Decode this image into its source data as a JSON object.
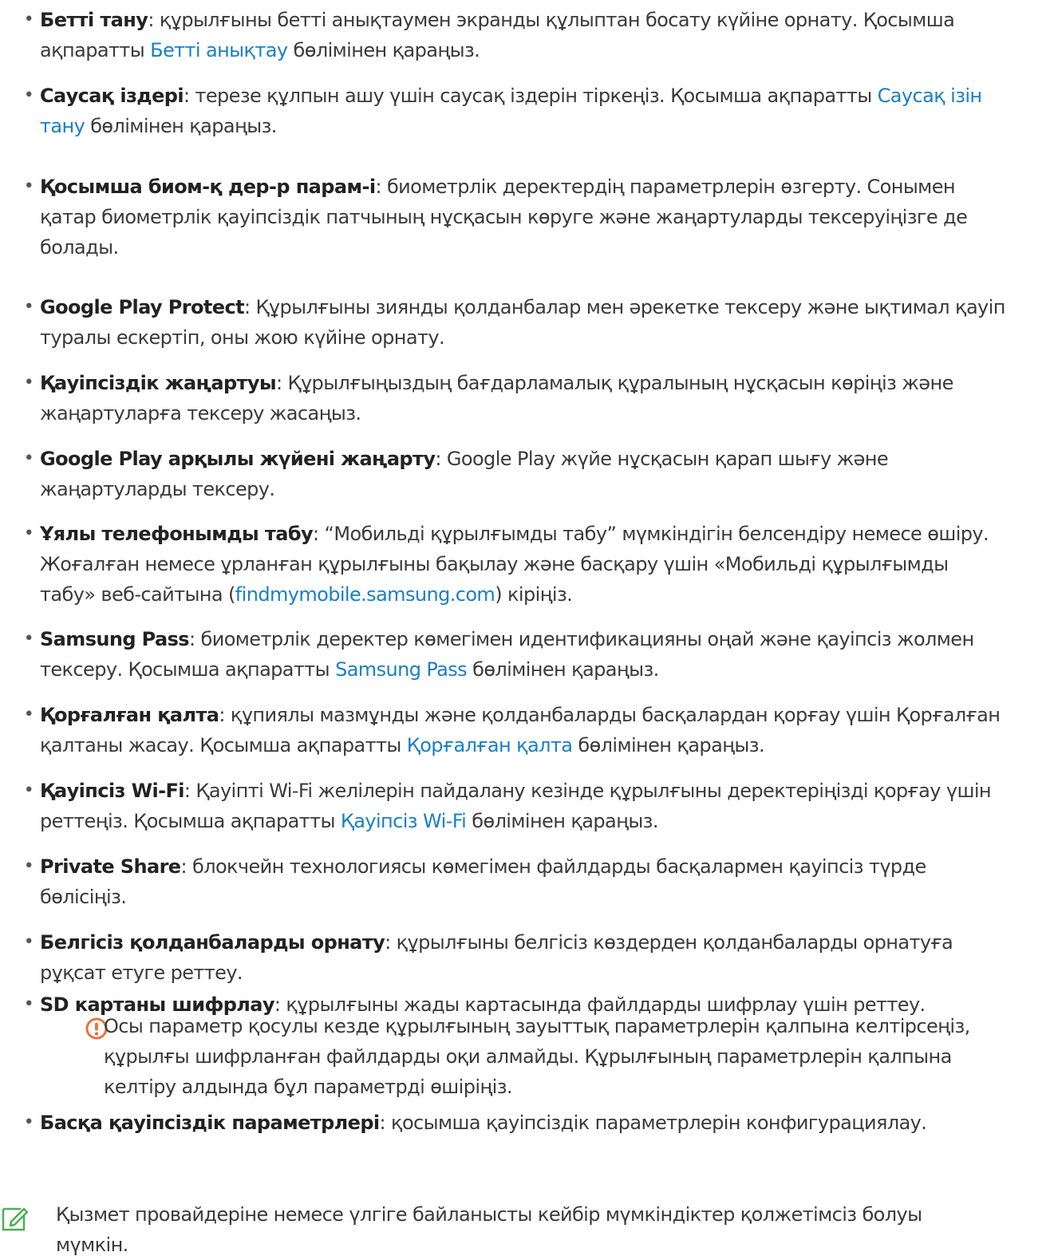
{
  "items": [
    {
      "term": "Бетті тану",
      "lines": [
        [
          {
            "t": ": құрылғыны бетті анықтаумен экранды құлыптан босату күйіне орнату. Қосымша"
          }
        ],
        [
          {
            "t": "ақпаратты "
          },
          {
            "t": "Бетті анықтау",
            "link": true
          },
          {
            "t": " бөлімінен қараңыз."
          }
        ]
      ]
    },
    {
      "term": "Саусақ іздері",
      "lines": [
        [
          {
            "t": ": терезе құлпын ашу үшін саусақ іздерін тіркеңіз. Қосымша ақпаратты "
          },
          {
            "t": "Саусақ ізін",
            "link": true
          }
        ],
        [
          {
            "t": "тану",
            "link": true
          },
          {
            "t": " бөлімінен қараңыз."
          }
        ]
      ]
    },
    {
      "term": "Қосымша биом-қ дер-р парам-і",
      "lines": [
        [
          {
            "t": ": биометрлік деректердің параметрлерін өзгерту. Сонымен"
          }
        ],
        [
          {
            "t": "қатар биометрлік қауіпсіздік патчының нұсқасын көруге және жаңартуларды тексеруіңізге де"
          }
        ],
        [
          {
            "t": "болады."
          }
        ]
      ]
    },
    {
      "term": "Google Play Protect",
      "lines": [
        [
          {
            "t": ": Құрылғыны зиянды қолданбалар мен әрекетке тексеру және ықтимал қауіп"
          }
        ],
        [
          {
            "t": "туралы ескертіп, оны жою күйіне орнату."
          }
        ]
      ]
    },
    {
      "term": "Қауіпсіздік жаңартуы",
      "lines": [
        [
          {
            "t": ": Құрылғыңыздың бағдарламалық құралының нұсқасын көріңіз және"
          }
        ],
        [
          {
            "t": "жаңартуларға тексеру жасаңыз."
          }
        ]
      ]
    },
    {
      "term": "Google Play арқылы жүйені жаңарту",
      "lines": [
        [
          {
            "t": ": Google Play жүйе нұсқасын қарап шығу және"
          }
        ],
        [
          {
            "t": "жаңартуларды тексеру."
          }
        ]
      ]
    },
    {
      "term": "Ұялы телефонымды табу",
      "lines": [
        [
          {
            "t": ": “Мобильді құрылғымды табу” мүмкіндігін белсендіру немесе өшіру."
          }
        ],
        [
          {
            "t": "Жоғалған немесе ұрланған құрылғыны бақылау және басқару үшін «Мобильді құрылғымды"
          }
        ],
        [
          {
            "t": "табу» веб-сайтына ("
          },
          {
            "t": "findmymobile.samsung.com",
            "link": true
          },
          {
            "t": ") кіріңіз."
          }
        ]
      ]
    },
    {
      "term": "Samsung Pass",
      "lines": [
        [
          {
            "t": ": биометрлік деректер көмегімен идентификацияны оңай және қауіпсіз жолмен"
          }
        ],
        [
          {
            "t": "тексеру. Қосымша ақпаратты "
          },
          {
            "t": "Samsung Pass",
            "link": true
          },
          {
            "t": " бөлімінен қараңыз."
          }
        ]
      ]
    },
    {
      "term": "Қорғалған қалта",
      "lines": [
        [
          {
            "t": ": құпиялы мазмұнды және қолданбаларды басқалардан қорғау үшін Қорғалған"
          }
        ],
        [
          {
            "t": "қалтаны жасау. Қосымша ақпаратты "
          },
          {
            "t": "Қорғалған қалта",
            "link": true
          },
          {
            "t": " бөлімінен қараңыз."
          }
        ]
      ]
    },
    {
      "term": "Қауіпсіз Wi-Fi",
      "lines": [
        [
          {
            "t": ": Қауіпті Wi-Fi желілерін пайдалану кезінде құрылғыны деректеріңізді қорғау үшін"
          }
        ],
        [
          {
            "t": "реттеңіз. Қосымша ақпаратты "
          },
          {
            "t": "Қауіпсіз Wi-Fi",
            "link": true
          },
          {
            "t": " бөлімінен қараңыз."
          }
        ]
      ]
    },
    {
      "term": "Private Share",
      "lines": [
        [
          {
            "t": ": блокчейн технологиясы көмегімен файлдарды басқалармен қауіпсіз түрде"
          }
        ],
        [
          {
            "t": "бөлісіңіз."
          }
        ]
      ]
    },
    {
      "term": "Белгісіз қолданбаларды орнату",
      "lines": [
        [
          {
            "t": ": құрылғыны белгісіз көздерден қолданбаларды орнатуға"
          }
        ],
        [
          {
            "t": "рұқсат етуге реттеу."
          }
        ]
      ]
    },
    {
      "term": "SD картаны шифрлау",
      "lines": [
        [
          {
            "t": ": құрылғыны жады картасында файлдарды шифрлау үшін реттеу."
          }
        ]
      ]
    },
    {
      "term": "Басқа қауіпсіздік параметрлері",
      "lines": [
        [
          {
            "t": ": қосымша қауіпсіздік параметрлерін конфигурациялау."
          }
        ]
      ]
    }
  ],
  "warning": {
    "icon": "warning-icon",
    "lines": [
      "Осы параметр қосулы кезде құрылғының зауыттық параметрлерін қалпына келтірсеңіз,",
      "құрылғы шифрланған файлдарды оқи алмайды. Құрылғының параметрлерін қалпына",
      "келтіру алдында бұл параметрді өшіріңіз."
    ],
    "color": "#e8743b"
  },
  "note": {
    "icon": "note-pencil-icon",
    "lines": [
      "Қызмет провайдеріне немесе үлгіге байланысты кейбір мүмкіндіктер қолжетімсіз болуы",
      "мүмкін."
    ],
    "color": "#4caf50"
  },
  "colors": {
    "link": "#1a7fc4",
    "text": "#3a3a3a",
    "bullet": "#555555"
  }
}
